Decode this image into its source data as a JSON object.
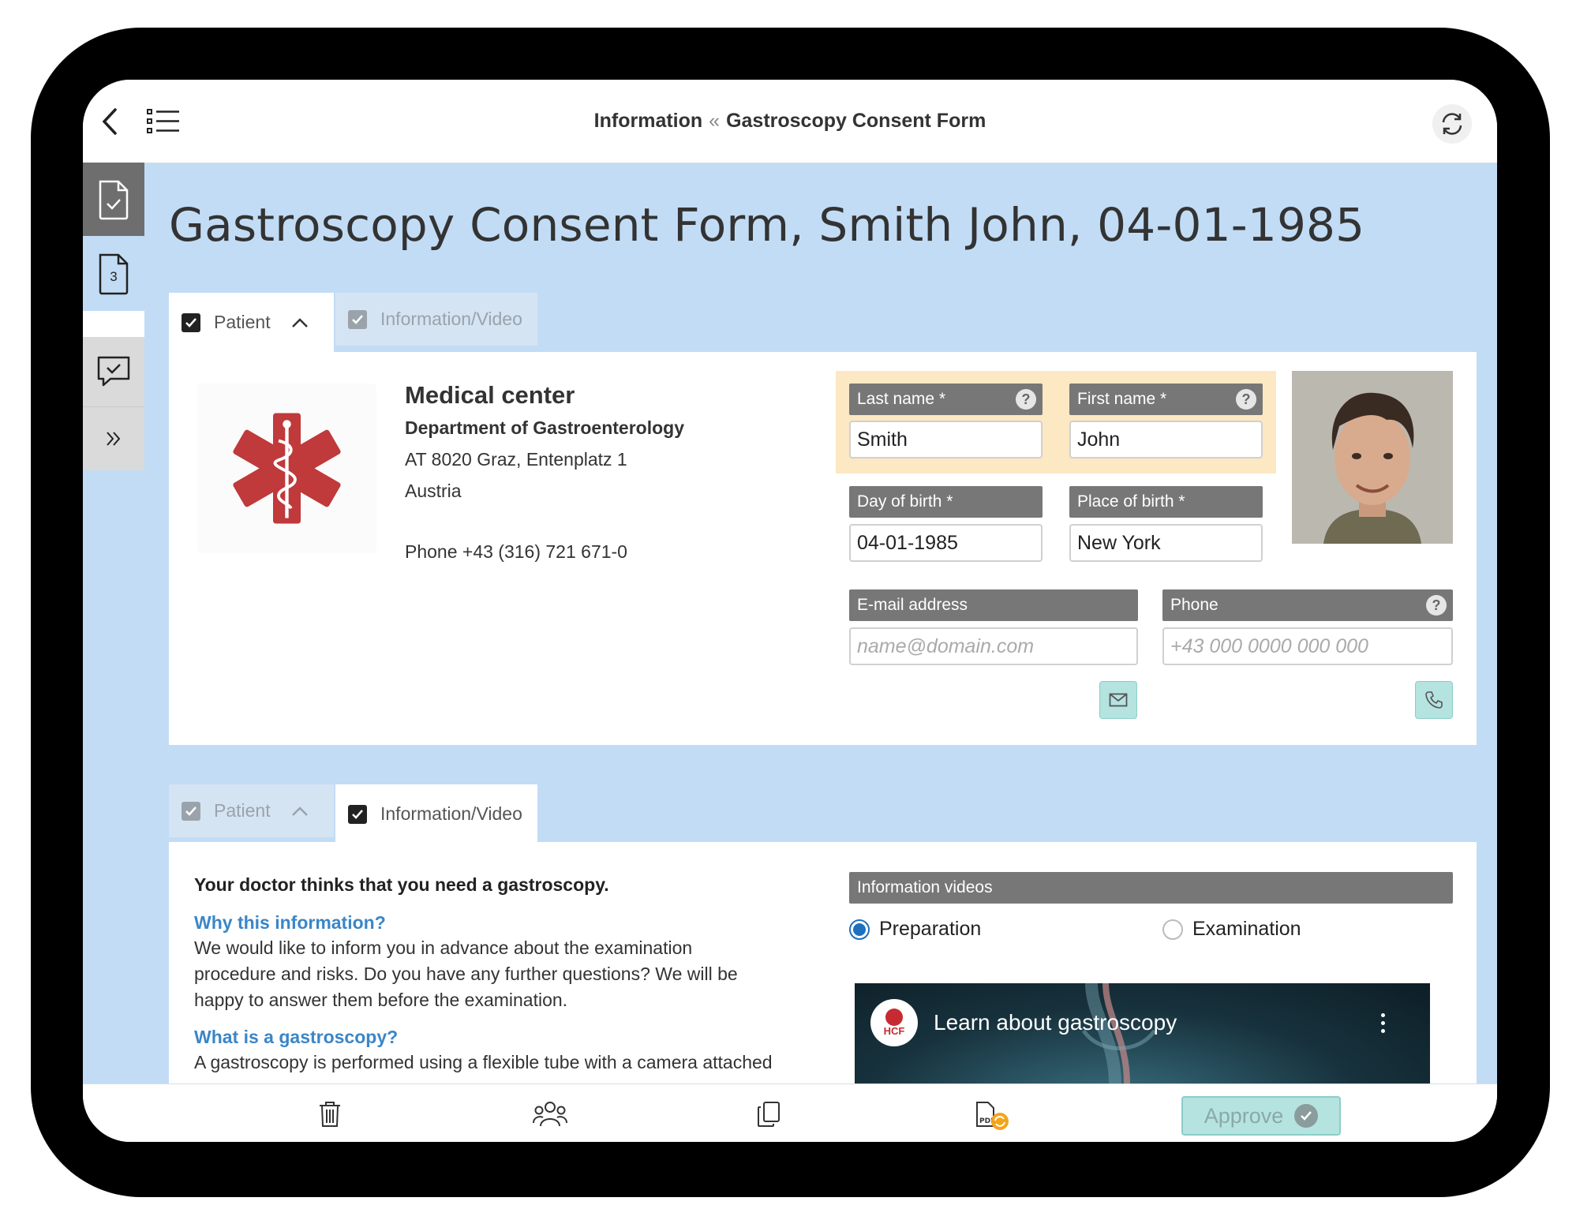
{
  "header": {
    "crumb_parent": "Information",
    "crumb_sep": "«",
    "crumb_current": "Gastroscopy Consent Form"
  },
  "rail": {
    "badge_count": "3"
  },
  "page_title": "Gastroscopy Consent Form, Smith John, 04-01-1985",
  "tabs": {
    "patient": "Patient",
    "info_video": "Information/Video"
  },
  "clinic": {
    "name": "Medical center",
    "department": "Department of Gastroenterology",
    "address": "AT 8020 Graz, Entenplatz 1",
    "country": "Austria",
    "phone": "Phone +43 (316) 721 671-0"
  },
  "patient_form": {
    "last_name_label": "Last name",
    "last_name_value": "Smith",
    "first_name_label": "First name",
    "first_name_value": "John",
    "dob_label": "Day of birth",
    "dob_value": "04-01-1985",
    "pob_label": "Place of birth",
    "pob_value": "New York",
    "email_label": "E-mail address",
    "email_placeholder": "name@domain.com",
    "phone_label": "Phone",
    "phone_placeholder": "+43 000 0000 000 000",
    "required_mark": "*",
    "help_mark": "?"
  },
  "info": {
    "intro": "Your doctor thinks that you need a gastroscopy.",
    "q1": "Why this information?",
    "a1_l1": "We would like to inform you in advance about the examination",
    "a1_l2": "procedure and risks. Do you have any further questions? We will be",
    "a1_l3": "happy to answer them before the examination.",
    "q2": "What is a gastroscopy?",
    "a2_l1": "A gastroscopy is performed using a flexible tube with a camera attached"
  },
  "videos": {
    "label": "Information videos",
    "option_1": "Preparation",
    "option_2": "Examination",
    "selected": "Preparation",
    "video_title": "Learn about gastroscopy",
    "channel_logo_text": "HCF"
  },
  "bottom": {
    "approve_label": "Approve"
  },
  "colors": {
    "main_bg": "#c2dcf5",
    "highlight_bg": "#fce8c3",
    "accent_blue": "#3a86c8",
    "approve_bg": "#b5e3e0",
    "logo_red": "#c0393b"
  }
}
